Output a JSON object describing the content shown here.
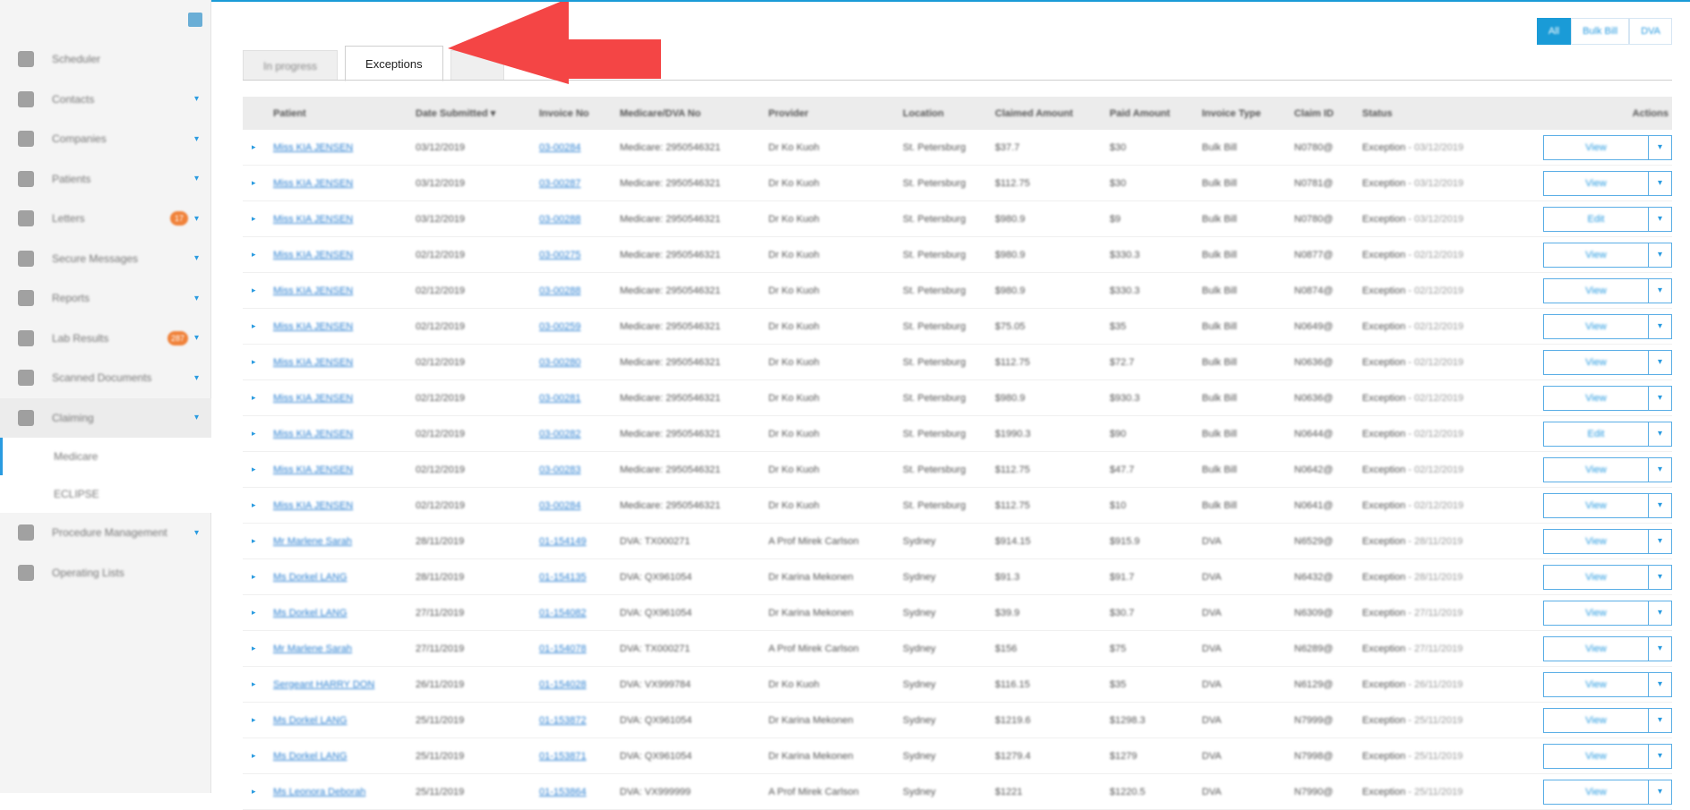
{
  "colors": {
    "accent": "#1a9bd7",
    "badge": "#f0823a",
    "arrow": "#f44545",
    "link": "#2a7fd1"
  },
  "sidebar": {
    "items": [
      {
        "label": "Scheduler",
        "icon": "calendar-icon",
        "chevron": false,
        "badge": ""
      },
      {
        "label": "Contacts",
        "icon": "contacts-icon",
        "chevron": true,
        "badge": ""
      },
      {
        "label": "Companies",
        "icon": "building-icon",
        "chevron": true,
        "badge": ""
      },
      {
        "label": "Patients",
        "icon": "person-icon",
        "chevron": true,
        "badge": ""
      },
      {
        "label": "Letters",
        "icon": "envelope-icon",
        "chevron": true,
        "badge": "17"
      },
      {
        "label": "Secure Messages",
        "icon": "message-icon",
        "chevron": true,
        "badge": ""
      },
      {
        "label": "Reports",
        "icon": "report-icon",
        "chevron": true,
        "badge": ""
      },
      {
        "label": "Lab Results",
        "icon": "flask-icon",
        "chevron": true,
        "badge": "287"
      },
      {
        "label": "Scanned Documents",
        "icon": "document-icon",
        "chevron": true,
        "badge": ""
      },
      {
        "label": "Claiming",
        "icon": "bank-icon",
        "chevron": true,
        "badge": ""
      }
    ],
    "subitems": [
      {
        "label": "Medicare"
      },
      {
        "label": "ECLIPSE"
      }
    ],
    "items_after": [
      {
        "label": "Procedure Management",
        "icon": "procedure-icon",
        "chevron": true
      },
      {
        "label": "Operating Lists",
        "icon": "list-icon",
        "chevron": false
      }
    ]
  },
  "filters": {
    "all": "All",
    "bulk_bill": "Bulk Bill",
    "dva": "DVA"
  },
  "tabs": [
    {
      "label": "In progress"
    },
    {
      "label": "Exceptions"
    },
    {
      "label": ""
    }
  ],
  "table": {
    "headers": {
      "patient": "Patient",
      "date": "Date Submitted ▾",
      "invoice": "Invoice No",
      "medicare": "Medicare/DVA No",
      "provider": "Provider",
      "location": "Location",
      "claimed": "Claimed Amount",
      "paid": "Paid Amount",
      "type": "Invoice Type",
      "claim_id": "Claim ID",
      "status": "Status",
      "actions": "Actions"
    },
    "rows": [
      {
        "patient": "Miss KIA JENSEN",
        "date": "03/12/2019",
        "invoice": "03-00284",
        "medicare": "Medicare: 2950546321",
        "provider": "Dr Ko Kuoh",
        "location": "St. Petersburg",
        "claimed": "$37.7",
        "paid": "$30",
        "type": "Bulk Bill",
        "claim_id": "N0780@",
        "status": "Exception",
        "status_date": " - 03/12/2019",
        "action": "View"
      },
      {
        "patient": "Miss KIA JENSEN",
        "date": "03/12/2019",
        "invoice": "03-00287",
        "medicare": "Medicare: 2950546321",
        "provider": "Dr Ko Kuoh",
        "location": "St. Petersburg",
        "claimed": "$112.75",
        "paid": "$30",
        "type": "Bulk Bill",
        "claim_id": "N0781@",
        "status": "Exception",
        "status_date": " - 03/12/2019",
        "action": "View"
      },
      {
        "patient": "Miss KIA JENSEN",
        "date": "03/12/2019",
        "invoice": "03-00288",
        "medicare": "Medicare: 2950546321",
        "provider": "Dr Ko Kuoh",
        "location": "St. Petersburg",
        "claimed": "$980.9",
        "paid": "$9",
        "type": "Bulk Bill",
        "claim_id": "N0780@",
        "status": "Exception",
        "status_date": " - 03/12/2019",
        "action": "Edit"
      },
      {
        "patient": "Miss KIA JENSEN",
        "date": "02/12/2019",
        "invoice": "03-00275",
        "medicare": "Medicare: 2950546321",
        "provider": "Dr Ko Kuoh",
        "location": "St. Petersburg",
        "claimed": "$980.9",
        "paid": "$330.3",
        "type": "Bulk Bill",
        "claim_id": "N0877@",
        "status": "Exception",
        "status_date": " - 02/12/2019",
        "action": "View"
      },
      {
        "patient": "Miss KIA JENSEN",
        "date": "02/12/2019",
        "invoice": "03-00288",
        "medicare": "Medicare: 2950546321",
        "provider": "Dr Ko Kuoh",
        "location": "St. Petersburg",
        "claimed": "$980.9",
        "paid": "$330.3",
        "type": "Bulk Bill",
        "claim_id": "N0874@",
        "status": "Exception",
        "status_date": " - 02/12/2019",
        "action": "View"
      },
      {
        "patient": "Miss KIA JENSEN",
        "date": "02/12/2019",
        "invoice": "03-00259",
        "medicare": "Medicare: 2950546321",
        "provider": "Dr Ko Kuoh",
        "location": "St. Petersburg",
        "claimed": "$75.05",
        "paid": "$35",
        "type": "Bulk Bill",
        "claim_id": "N0649@",
        "status": "Exception",
        "status_date": " - 02/12/2019",
        "action": "View"
      },
      {
        "patient": "Miss KIA JENSEN",
        "date": "02/12/2019",
        "invoice": "03-00280",
        "medicare": "Medicare: 2950546321",
        "provider": "Dr Ko Kuoh",
        "location": "St. Petersburg",
        "claimed": "$112.75",
        "paid": "$72.7",
        "type": "Bulk Bill",
        "claim_id": "N0636@",
        "status": "Exception",
        "status_date": " - 02/12/2019",
        "action": "View"
      },
      {
        "patient": "Miss KIA JENSEN",
        "date": "02/12/2019",
        "invoice": "03-00281",
        "medicare": "Medicare: 2950546321",
        "provider": "Dr Ko Kuoh",
        "location": "St. Petersburg",
        "claimed": "$980.9",
        "paid": "$930.3",
        "type": "Bulk Bill",
        "claim_id": "N0636@",
        "status": "Exception",
        "status_date": " - 02/12/2019",
        "action": "View"
      },
      {
        "patient": "Miss KIA JENSEN",
        "date": "02/12/2019",
        "invoice": "03-00282",
        "medicare": "Medicare: 2950546321",
        "provider": "Dr Ko Kuoh",
        "location": "St. Petersburg",
        "claimed": "$1990.3",
        "paid": "$90",
        "type": "Bulk Bill",
        "claim_id": "N0644@",
        "status": "Exception",
        "status_date": " - 02/12/2019",
        "action": "Edit"
      },
      {
        "patient": "Miss KIA JENSEN",
        "date": "02/12/2019",
        "invoice": "03-00283",
        "medicare": "Medicare: 2950546321",
        "provider": "Dr Ko Kuoh",
        "location": "St. Petersburg",
        "claimed": "$112.75",
        "paid": "$47.7",
        "type": "Bulk Bill",
        "claim_id": "N0642@",
        "status": "Exception",
        "status_date": " - 02/12/2019",
        "action": "View"
      },
      {
        "patient": "Miss KIA JENSEN",
        "date": "02/12/2019",
        "invoice": "03-00284",
        "medicare": "Medicare: 2950546321",
        "provider": "Dr Ko Kuoh",
        "location": "St. Petersburg",
        "claimed": "$112.75",
        "paid": "$10",
        "type": "Bulk Bill",
        "claim_id": "N0641@",
        "status": "Exception",
        "status_date": " - 02/12/2019",
        "action": "View"
      },
      {
        "patient": "Mr Marlene Sarah",
        "date": "28/11/2019",
        "invoice": "01-154149",
        "medicare": "DVA: TX000271",
        "provider": "A Prof Mirek Carlson",
        "location": "Sydney",
        "claimed": "$914.15",
        "paid": "$915.9",
        "type": "DVA",
        "claim_id": "N6529@",
        "status": "Exception",
        "status_date": " - 28/11/2019",
        "action": "View"
      },
      {
        "patient": "Ms Dorkel LANG",
        "date": "28/11/2019",
        "invoice": "01-154135",
        "medicare": "DVA: QX961054",
        "provider": "Dr Karina Mekonen",
        "location": "Sydney",
        "claimed": "$91.3",
        "paid": "$91.7",
        "type": "DVA",
        "claim_id": "N6432@",
        "status": "Exception",
        "status_date": " - 28/11/2019",
        "action": "View"
      },
      {
        "patient": "Ms Dorkel LANG",
        "date": "27/11/2019",
        "invoice": "01-154082",
        "medicare": "DVA: QX961054",
        "provider": "Dr Karina Mekonen",
        "location": "Sydney",
        "claimed": "$39.9",
        "paid": "$30.7",
        "type": "DVA",
        "claim_id": "N6309@",
        "status": "Exception",
        "status_date": " - 27/11/2019",
        "action": "View"
      },
      {
        "patient": "Mr Marlene Sarah",
        "date": "27/11/2019",
        "invoice": "01-154078",
        "medicare": "DVA: TX000271",
        "provider": "A Prof Mirek Carlson",
        "location": "Sydney",
        "claimed": "$156",
        "paid": "$75",
        "type": "DVA",
        "claim_id": "N6289@",
        "status": "Exception",
        "status_date": " - 27/11/2019",
        "action": "View"
      },
      {
        "patient": "Sergeant HARRY DON",
        "date": "26/11/2019",
        "invoice": "01-154028",
        "medicare": "DVA: VX999784",
        "provider": "Dr Ko Kuoh",
        "location": "Sydney",
        "claimed": "$116.15",
        "paid": "$35",
        "type": "DVA",
        "claim_id": "N6129@",
        "status": "Exception",
        "status_date": " - 26/11/2019",
        "action": "View"
      },
      {
        "patient": "Ms Dorkel LANG",
        "date": "25/11/2019",
        "invoice": "01-153872",
        "medicare": "DVA: QX961054",
        "provider": "Dr Karina Mekonen",
        "location": "Sydney",
        "claimed": "$1219.6",
        "paid": "$1298.3",
        "type": "DVA",
        "claim_id": "N7999@",
        "status": "Exception",
        "status_date": " - 25/11/2019",
        "action": "View"
      },
      {
        "patient": "Ms Dorkel LANG",
        "date": "25/11/2019",
        "invoice": "01-153871",
        "medicare": "DVA: QX961054",
        "provider": "Dr Karina Mekonen",
        "location": "Sydney",
        "claimed": "$1279.4",
        "paid": "$1279",
        "type": "DVA",
        "claim_id": "N7998@",
        "status": "Exception",
        "status_date": " - 25/11/2019",
        "action": "View"
      },
      {
        "patient": "Ms Leonora Deborah",
        "date": "25/11/2019",
        "invoice": "01-153864",
        "medicare": "DVA: VX999999",
        "provider": "A Prof Mirek Carlson",
        "location": "Sydney",
        "claimed": "$1221",
        "paid": "$1220.5",
        "type": "DVA",
        "claim_id": "N7990@",
        "status": "Exception",
        "status_date": " - 25/11/2019",
        "action": "View"
      }
    ]
  }
}
